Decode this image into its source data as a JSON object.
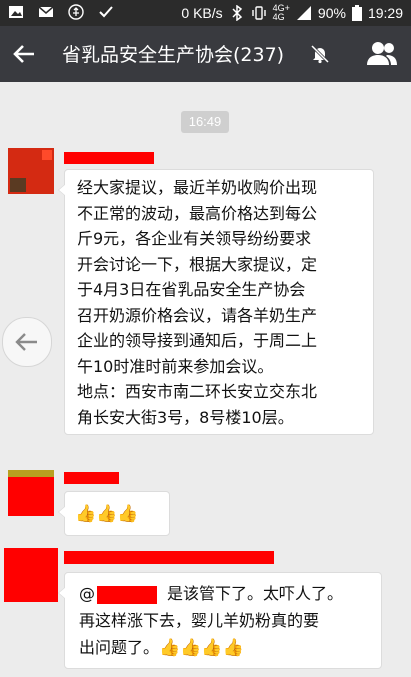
{
  "status_bar": {
    "net_speed": "0 KB/s",
    "network": "4G+",
    "signal_label": "4G",
    "battery": "90%",
    "time": "19:29",
    "icons": [
      "image-icon",
      "mail-icon",
      "usb-icon",
      "check-icon",
      "bluetooth-icon",
      "vibrate-icon",
      "signal-icon",
      "battery-icon"
    ]
  },
  "header": {
    "title": "省乳品安全生产协会(237)",
    "back_icon": "arrow-left-icon",
    "mute_icon": "bell-muted-icon",
    "group_icon": "group-members-icon"
  },
  "chat": {
    "timestamp": "16:49",
    "messages": [
      {
        "lines": [
          "经大家提议，最近羊奶收购价出现",
          "不正常的波动，最高价格达到每公",
          "斤9元，各企业有关领导纷纷要求",
          "开会讨论一下，根据大家提议，定",
          "于4月3日在省乳品安全生产协会",
          "召开奶源价格会议，请各羊奶生产",
          "企业的领导接到通知后，于周二上",
          "午10时准时前来参加会议。",
          "地点：西安市南二环长安立交东北",
          "角长安大街3号，8号楼10层。"
        ]
      },
      {
        "emoji": "👍👍👍"
      },
      {
        "line1_prefix": "@",
        "line1_suffix": "是该管下了。太吓人了。",
        "line2": "再这样涨下去，婴儿羊奶粉真的要",
        "line3": "出问题了。",
        "emoji": "👍👍👍👍"
      }
    ]
  },
  "colors": {
    "status_bar": "#2b2b2b",
    "title_bar": "#393a3f",
    "chat_bg": "#ececec",
    "redaction": "#ff0000"
  }
}
